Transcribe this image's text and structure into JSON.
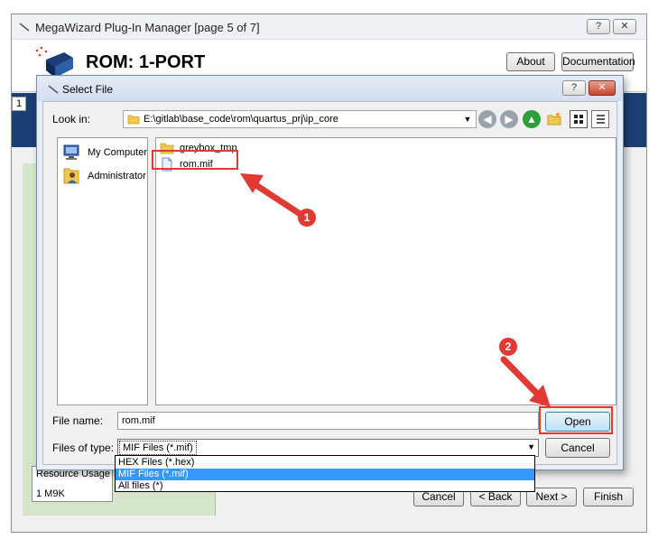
{
  "outer_window": {
    "title": "MegaWizard Plug-In Manager [page 5 of 7]",
    "help_label": "?",
    "close_label": "✕",
    "header_title": "ROM: 1-PORT",
    "about_label": "About",
    "documentation_label": "Documentation",
    "step_number": "1",
    "resource_usage_label": "Resource Usage",
    "resource_usage_value": "1 M9K",
    "buttons": {
      "cancel": "Cancel",
      "back": "< Back",
      "next": "Next >",
      "finish": "Finish"
    }
  },
  "dialog": {
    "title": "Select File",
    "help_label": "?",
    "close_label": "✕",
    "look_in_label": "Look in:",
    "look_in_path": "E:\\gitlab\\base_code\\rom\\quartus_prj\\ip_core",
    "places": [
      {
        "label": "My Computer",
        "icon": "computer-icon"
      },
      {
        "label": "Administrator",
        "icon": "user-icon"
      }
    ],
    "files": [
      {
        "name": "greybox_tmp",
        "type": "folder"
      },
      {
        "name": "rom.mif",
        "type": "file"
      }
    ],
    "file_name_label": "File name:",
    "file_name_value": "rom.mif",
    "files_of_type_label": "Files of type:",
    "files_of_type_value": "MIF Files (*.mif)",
    "type_options": [
      "HEX Files (*.hex)",
      "MIF Files (*.mif)",
      "All files (*)"
    ],
    "selected_type_index": 1,
    "open_label": "Open",
    "cancel_label": "Cancel"
  },
  "annotations": [
    {
      "label": "1"
    },
    {
      "label": "2"
    }
  ],
  "colors": {
    "annotation_red": "#e03a32",
    "header_blue": "#1b3f74",
    "selection_blue": "#3399ff",
    "panel_green": "#d5e6c8",
    "folder_yellow": "#f2c94c"
  }
}
